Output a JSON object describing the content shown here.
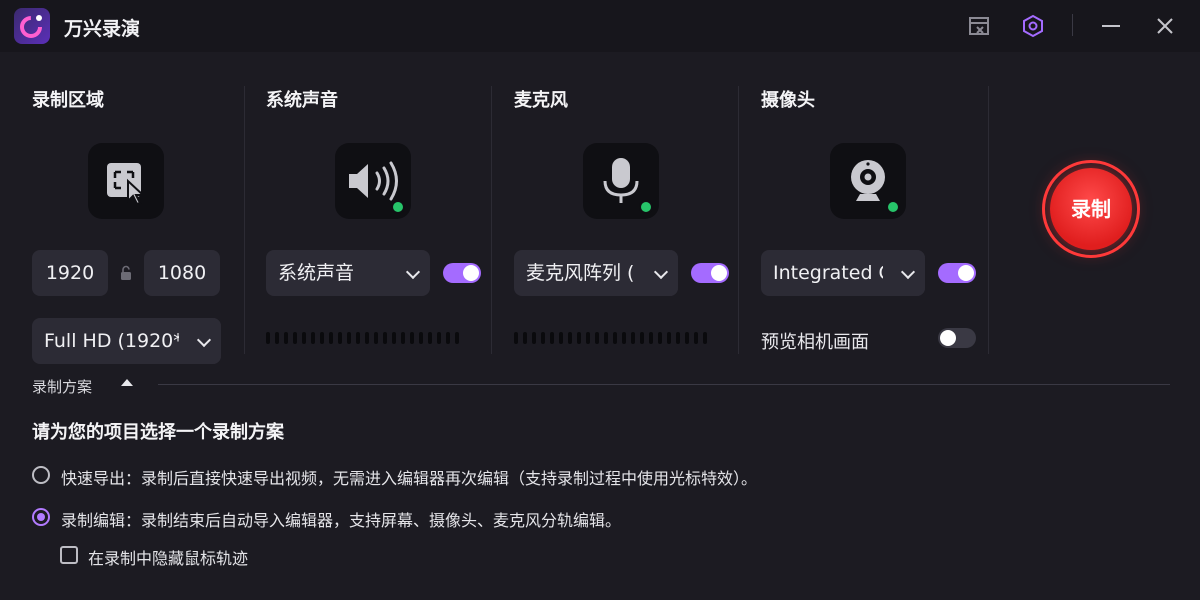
{
  "app": {
    "title": "万兴录演"
  },
  "sections": {
    "area": {
      "title": "录制区域",
      "width": "1920",
      "height": "1080",
      "preset": "Full HD (1920*1"
    },
    "system_audio": {
      "title": "系统声音",
      "device": "系统声音",
      "enabled": true
    },
    "mic": {
      "title": "麦克风",
      "device": "麦克风阵列 (I",
      "enabled": true
    },
    "camera": {
      "title": "摄像头",
      "device": "Integrated C",
      "enabled": true,
      "preview_label": "预览相机画面",
      "preview_enabled": false
    }
  },
  "record_button": {
    "label": "录制"
  },
  "scheme": {
    "label": "录制方案",
    "heading": "请为您的项目选择一个录制方案",
    "options": [
      {
        "label": "快速导出：录制后直接快速导出视频，无需进入编辑器再次编辑（支持录制过程中使用光标特效）。",
        "selected": false
      },
      {
        "label": "录制编辑：录制结束后自动导入编辑器，支持屏幕、摄像头、麦克风分轨编辑。",
        "selected": true
      }
    ],
    "hide_cursor_label": "在录制中隐藏鼠标轨迹",
    "hide_cursor_checked": false
  },
  "colors": {
    "accent": "#a46bff",
    "record": "#e01e1e",
    "ok": "#27c46a"
  },
  "icons": [
    "app-logo-icon",
    "screenshot-frame-icon",
    "hexagon-settings-icon",
    "minimize-icon",
    "close-icon",
    "area-select-icon",
    "lock-icon",
    "speaker-icon",
    "microphone-icon",
    "webcam-icon"
  ]
}
